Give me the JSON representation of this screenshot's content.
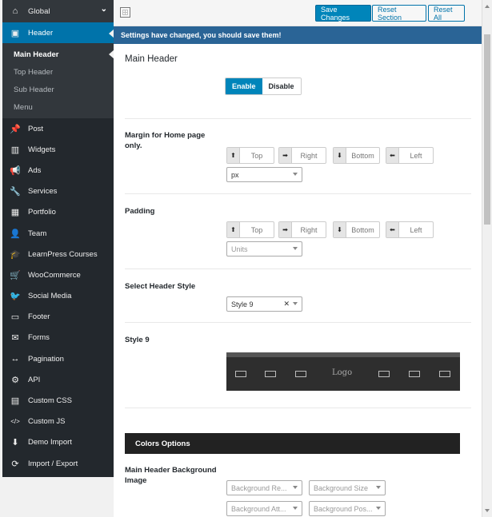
{
  "sidebar": {
    "global": {
      "label": "Global",
      "icon": "home-icon"
    },
    "header": {
      "label": "Header",
      "icon": "window-icon"
    },
    "sub_items": [
      "Main Header",
      "Top Header",
      "Sub Header",
      "Menu"
    ],
    "items": [
      {
        "label": "Post",
        "icon": "pin-icon",
        "glyph": "📌"
      },
      {
        "label": "Widgets",
        "icon": "columns-icon",
        "glyph": "▥"
      },
      {
        "label": "Ads",
        "icon": "megaphone-icon",
        "glyph": "📢"
      },
      {
        "label": "Services",
        "icon": "wrench-icon",
        "glyph": "🔧"
      },
      {
        "label": "Portfolio",
        "icon": "grid-icon",
        "glyph": "▦"
      },
      {
        "label": "Team",
        "icon": "user-icon",
        "glyph": "👤"
      },
      {
        "label": "LearnPress Courses",
        "icon": "graduation-cap-icon",
        "glyph": "🎓"
      },
      {
        "label": "WooCommerce",
        "icon": "cart-icon",
        "glyph": "🛒"
      },
      {
        "label": "Social Media",
        "icon": "twitter-icon",
        "glyph": "🐦"
      },
      {
        "label": "Footer",
        "icon": "monitor-icon",
        "glyph": "▭"
      },
      {
        "label": "Forms",
        "icon": "envelope-icon",
        "glyph": "✉"
      },
      {
        "label": "Pagination",
        "icon": "arrows-horizontal-icon",
        "glyph": "↔"
      },
      {
        "label": "API",
        "icon": "cogs-icon",
        "glyph": "⚙"
      },
      {
        "label": "Custom CSS",
        "icon": "css-file-icon",
        "glyph": "▤"
      },
      {
        "label": "Custom JS",
        "icon": "code-icon",
        "glyph": "</>"
      },
      {
        "label": "Demo Import",
        "icon": "download-circle-icon",
        "glyph": "⬇"
      },
      {
        "label": "Import / Export",
        "icon": "refresh-icon",
        "glyph": "⟳"
      }
    ]
  },
  "toolbar": {
    "save_label": "Save Changes",
    "reset_section_label": "Reset Section",
    "reset_all_label": "Reset All"
  },
  "notice": "Settings have changed, you should save them!",
  "main": {
    "title": "Main Header",
    "toggle": {
      "enable": "Enable",
      "disable": "Disable",
      "selected": "Enable"
    },
    "margin": {
      "label": "Margin for Home page only.",
      "top": "Top",
      "right": "Right",
      "bottom": "Bottom",
      "left": "Left",
      "unit": "px"
    },
    "padding": {
      "label": "Padding",
      "top": "Top",
      "right": "Right",
      "bottom": "Bottom",
      "left": "Left",
      "unit_placeholder": "Units"
    },
    "header_style": {
      "label": "Select Header Style",
      "value": "Style 9"
    },
    "style_preview": {
      "label": "Style 9",
      "logo_text": "Logo"
    },
    "colors_section": "Colors Options",
    "bg_image": {
      "label": "Main Header Background Image",
      "repeat_placeholder": "Background Re...",
      "size_placeholder": "Background Size",
      "attachment_placeholder": "Background Att...",
      "position_placeholder": "Background Pos..."
    }
  },
  "colors": {
    "accent": "#0085ba",
    "sidebar_bg": "#23282d",
    "notice_bg": "#2a6496"
  }
}
